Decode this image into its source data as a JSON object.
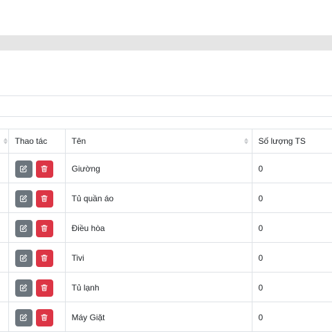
{
  "table": {
    "columns": {
      "actions": "Thao tác",
      "name": "Tên",
      "quantity": "Số lượng TS"
    },
    "rows": [
      {
        "name": "Giường",
        "quantity": "0"
      },
      {
        "name": "Tủ quần áo",
        "quantity": "0"
      },
      {
        "name": "Điều hòa",
        "quantity": "0"
      },
      {
        "name": "Tivi",
        "quantity": "0"
      },
      {
        "name": "Tủ lạnh",
        "quantity": "0"
      },
      {
        "name": "Máy Giặt",
        "quantity": "0"
      }
    ]
  },
  "icons": {
    "edit": "edit-icon",
    "delete": "trash-icon",
    "sort": "sort-icon"
  },
  "colors": {
    "edit_button": "#6c757d",
    "delete_button": "#dc3545",
    "header_band": "#e5e5e5",
    "border": "#dee2e6"
  }
}
